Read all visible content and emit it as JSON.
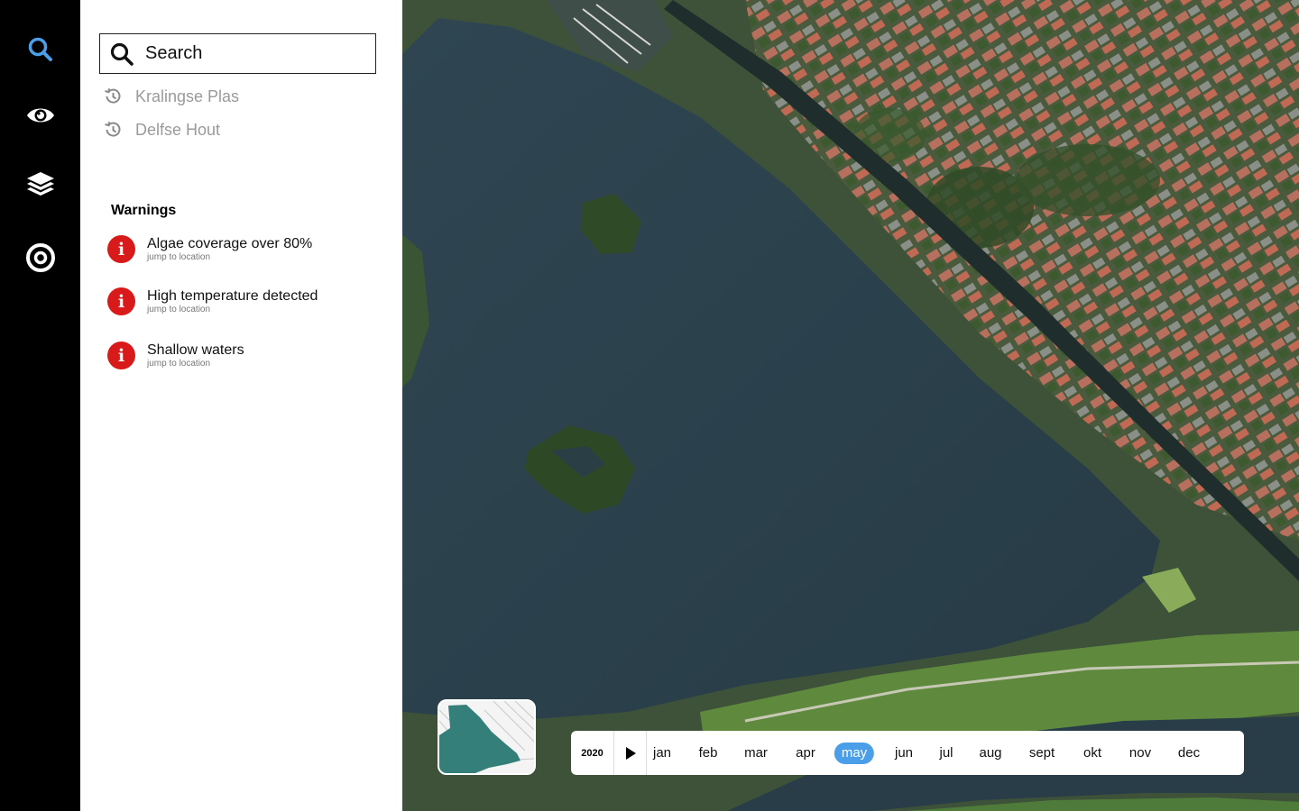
{
  "rail": {
    "items": [
      {
        "name": "search-icon",
        "color": "#4a9fe8",
        "active": true
      },
      {
        "name": "eye-icon",
        "color": "#ffffff",
        "active": false
      },
      {
        "name": "layers-icon",
        "color": "#ffffff",
        "active": false
      },
      {
        "name": "target-icon",
        "color": "#ffffff",
        "active": false
      }
    ]
  },
  "search": {
    "placeholder": "Search",
    "recent": [
      {
        "label": "Kralingse Plas",
        "icon": "history-icon"
      },
      {
        "label": "Delfse Hout",
        "icon": "history-icon"
      }
    ]
  },
  "warnings": {
    "title": "Warnings",
    "items": [
      {
        "title": "Algae coverage over 80%",
        "link": "jump to location",
        "icon": "info-icon"
      },
      {
        "title": "High temperature detected",
        "link": "jump to location",
        "icon": "info-icon"
      },
      {
        "title": "Shallow waters",
        "link": "jump to location",
        "icon": "info-icon"
      }
    ],
    "icon_glyph": "i",
    "color": "#d91a1a"
  },
  "timeline": {
    "year": "2020",
    "months": [
      "jan",
      "feb",
      "mar",
      "apr",
      "may",
      "jun",
      "jul",
      "aug",
      "sept",
      "okt",
      "nov",
      "dec"
    ],
    "selected": "may",
    "accent": "#4a9fe8"
  },
  "minimap": {
    "water_color": "#357f7a"
  }
}
